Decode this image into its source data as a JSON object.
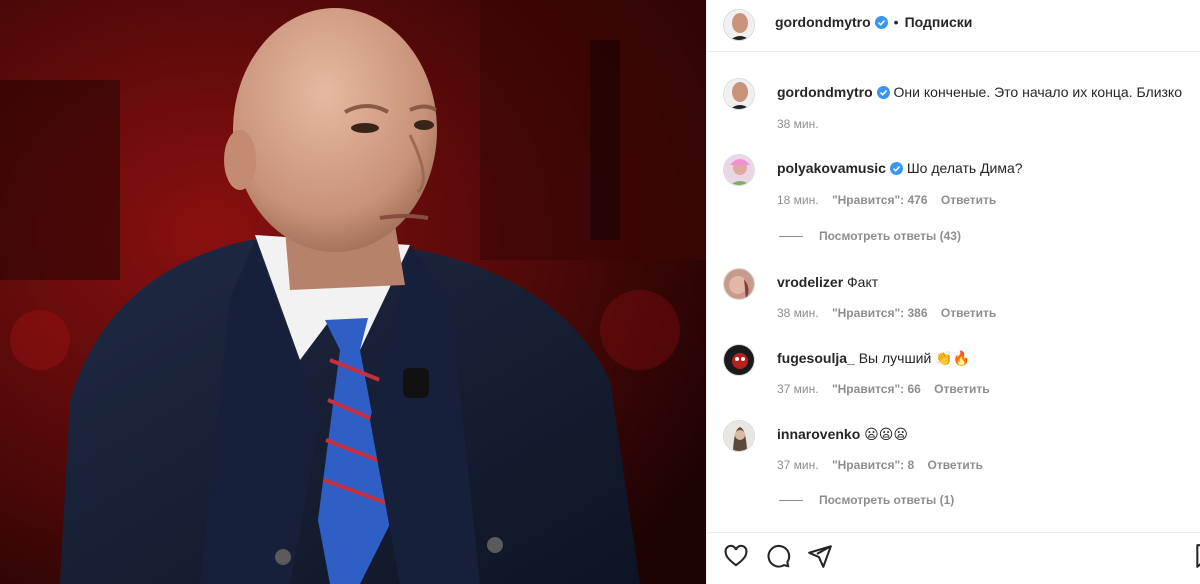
{
  "post": {
    "author": "gordondmytro",
    "follow_status": "Подписки",
    "separator": "•",
    "caption_text": "Они конченые. Это начало их конца. Близко",
    "caption_time": "38 мин."
  },
  "comments": [
    {
      "username": "polyakovamusic",
      "verified": true,
      "text": "Шо делать Дима?",
      "time": "18 мин.",
      "likes": "\"Нравится\": 476",
      "reply": "Ответить",
      "view_replies": "Посмотреть ответы (43)"
    },
    {
      "username": "vrodelizer",
      "verified": false,
      "text": "Факт",
      "time": "38 мин.",
      "likes": "\"Нравится\": 386",
      "reply": "Ответить",
      "view_replies": ""
    },
    {
      "username": "fugesoulja_",
      "verified": false,
      "text": "Вы лучший 👏🔥",
      "time": "37 мин.",
      "likes": "\"Нравится\": 66",
      "reply": "Ответить",
      "view_replies": ""
    },
    {
      "username": "innarovenko",
      "verified": false,
      "text": "😦😦😦",
      "time": "37 мин.",
      "likes": "\"Нравится\": 8",
      "reply": "Ответить",
      "view_replies": "Посмотреть ответы (1)"
    }
  ],
  "icons": {
    "like": "heart-icon",
    "comment": "comment-icon",
    "share": "share-icon",
    "save": "bookmark-icon",
    "verified": "verified-badge-icon"
  },
  "colors": {
    "text": "#262626",
    "muted": "#8e8e8e",
    "verified": "#3897f0",
    "photo_background": "#6e0b0b"
  }
}
